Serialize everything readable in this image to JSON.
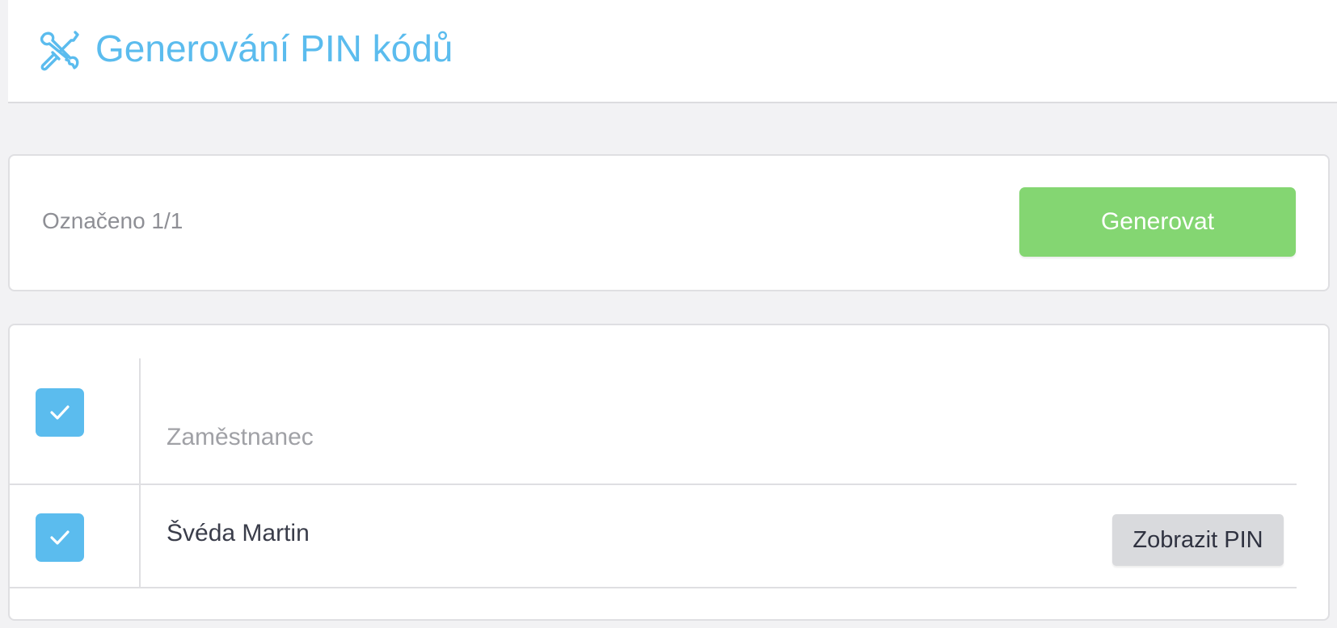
{
  "header": {
    "title": "Generování PIN kódů",
    "icon": "tools-icon"
  },
  "actions": {
    "selected_text": "Označeno 1/1",
    "generate_label": "Generovat"
  },
  "table": {
    "header_checkbox_checked": true,
    "column_label": "Zaměstnanec",
    "rows": [
      {
        "name": "Švéda Martin",
        "checked": true,
        "action_label": "Zobrazit PIN"
      }
    ]
  },
  "colors": {
    "accent": "#5bbcee",
    "generate_button": "#84d672",
    "secondary_button": "#d9dadd",
    "background": "#f2f2f4"
  }
}
